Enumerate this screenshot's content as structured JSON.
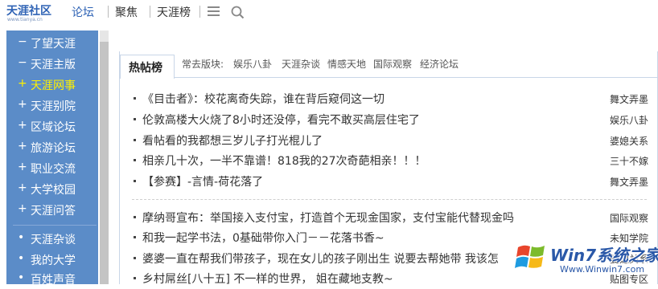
{
  "header": {
    "logo_text": "天涯社区",
    "logo_subtext": "www.tianya.cn",
    "nav": [
      "论坛",
      "聚焦",
      "天涯榜"
    ],
    "menu_icon": "hamburger-icon",
    "search_icon": "search-icon"
  },
  "sidebar": {
    "items": [
      {
        "mark": "−",
        "label": "了望天涯"
      },
      {
        "mark": "−",
        "label": "天涯主版"
      },
      {
        "mark": "+",
        "label": "天涯网事"
      },
      {
        "mark": "+",
        "label": "天涯别院"
      },
      {
        "mark": "+",
        "label": "区域论坛"
      },
      {
        "mark": "+",
        "label": "旅游论坛"
      },
      {
        "mark": "+",
        "label": "职业交流"
      },
      {
        "mark": "+",
        "label": "大学校园"
      },
      {
        "mark": "+",
        "label": "天涯问答"
      },
      {
        "mark": "•",
        "label": "天涯杂谈"
      },
      {
        "mark": "•",
        "label": "我的大学"
      },
      {
        "mark": "•",
        "label": "百姓声音"
      }
    ],
    "active_label": "天涯网事"
  },
  "tabs": {
    "hot_label": "热帖榜",
    "common_label": "常去版块:",
    "boards": [
      "娱乐八卦",
      "天涯杂谈",
      "情感天地",
      "国际观察",
      "经济论坛"
    ]
  },
  "posts": [
    {
      "title": "《目击者》：校花离奇失踪，谁在背后窥伺这一切",
      "board": "舞文弄墨"
    },
    {
      "title": "伦敦高楼大火烧了8小时还没停，看完不敢买高层住宅了",
      "board": "娱乐八卦"
    },
    {
      "title": "看帖看的我都想三岁儿子打光棍儿了",
      "board": "婆媳关系"
    },
    {
      "title": "相亲几十次，一半不靠谱！818我的27次奇葩相亲！！！",
      "board": "三十不嫁"
    },
    {
      "title": "【参赛】-言情-荷花落了",
      "board": "舞文弄墨"
    },
    {
      "title": "摩纳哥宣布：举国接入支付宝，打造首个无现金国家，支付宝能代替现金吗",
      "board": "国际观察"
    },
    {
      "title": "和我一起学书法，0基础带你入门－－花落书香~",
      "board": "未知学院"
    },
    {
      "title": "婆婆一直在帮我们带孩子，现在女儿的孩子刚出生 说要去帮她带 我该怎",
      "board": "婆媳关系"
    },
    {
      "title": "乡村屌丝[八十五] 不一样的世界， 姐在藏地支教~",
      "board": "贴图专区"
    }
  ],
  "watermark": {
    "brand": "Win7系统之家",
    "url": "Www.Winwin7.com"
  },
  "colors": {
    "sidebar_bg": "#5b8cc8",
    "active_item": "#fff100",
    "link_blue": "#2f63b5"
  }
}
